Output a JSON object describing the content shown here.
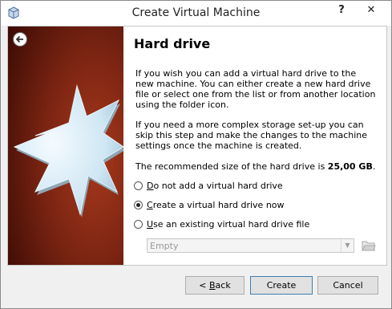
{
  "window": {
    "title": "Create Virtual Machine",
    "help_label": "?",
    "close_label": "✕"
  },
  "page": {
    "heading": "Hard drive",
    "paragraph1": "If you wish you can add a virtual hard drive to the new machine. You can either create a new hard drive file or select one from the list or from another location using the folder icon.",
    "paragraph2": "If you need a more complex storage set-up you can skip this step and make the changes to the machine settings once the machine is created.",
    "recommended_prefix": "The recommended size of the hard drive is ",
    "recommended_size": "25,00 GB",
    "recommended_suffix": "."
  },
  "options": [
    {
      "mnemonic": "D",
      "rest": "o not add a virtual hard drive",
      "checked": false
    },
    {
      "mnemonic": "C",
      "rest": "reate a virtual hard drive now",
      "checked": true
    },
    {
      "mnemonic": "U",
      "rest": "se an existing virtual hard drive file",
      "checked": false
    }
  ],
  "combo": {
    "value": "Empty",
    "enabled": false
  },
  "buttons": {
    "back_prefix": "< ",
    "back_mnemonic": "B",
    "back_rest": "ack",
    "create": "Create",
    "cancel": "Cancel"
  },
  "colors": {
    "banner_dark": "#5a1208",
    "banner_mid": "#8a2a14",
    "star": "#d6ecf7"
  }
}
